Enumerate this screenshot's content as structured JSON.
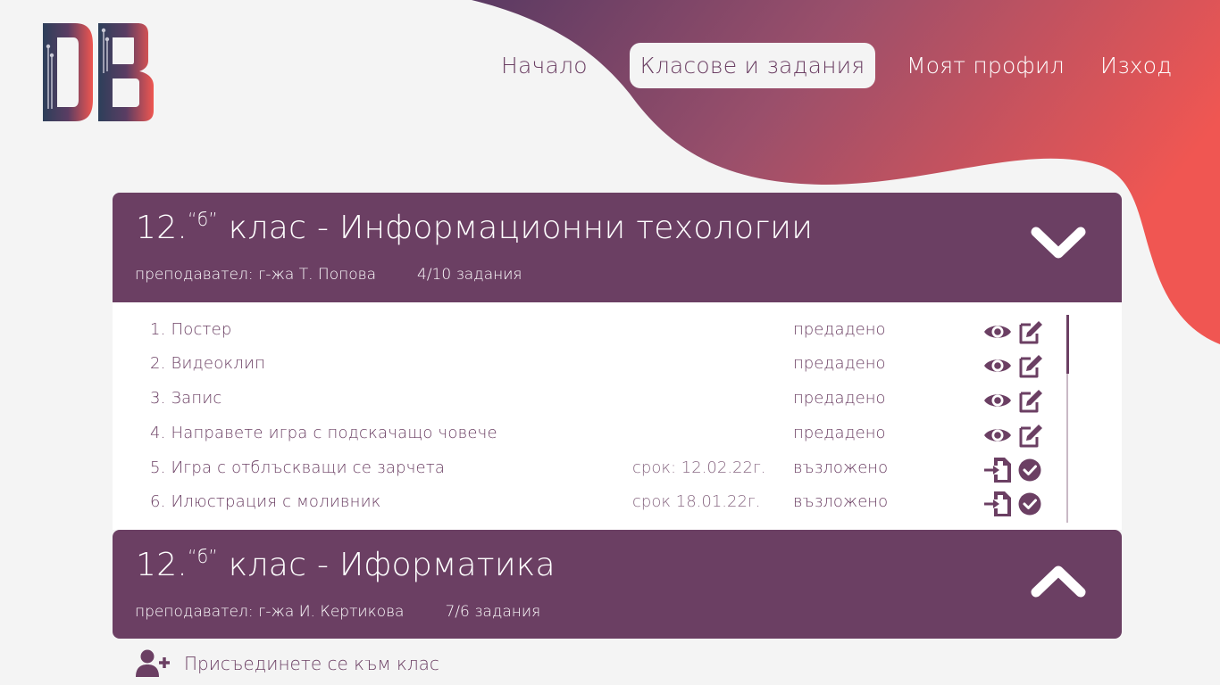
{
  "colors": {
    "primary": "#6b3f63",
    "accent": "#ef5650",
    "background": "#f4f4f4"
  },
  "logo": {
    "text": "DB",
    "icon": "db-logo-icon"
  },
  "nav": {
    "home": "Начало",
    "classes": "Класове и задания",
    "profile": "Моят профил",
    "exit": "Изход"
  },
  "classes": [
    {
      "grade": "12.",
      "section": "“б”",
      "rest": " клас - Информационни техологии",
      "teacher": "преподавател: г-жа Т. Попова",
      "count": "4/10 задания",
      "expanded": true,
      "toggle_icon": "chevron-down-icon",
      "tasks": [
        {
          "name": "1. Постер",
          "due": "",
          "status": "предадено",
          "actions": [
            "eye-icon",
            "edit-icon"
          ]
        },
        {
          "name": "2. Видеоклип",
          "due": "",
          "status": "предадено",
          "actions": [
            "eye-icon",
            "edit-icon"
          ]
        },
        {
          "name": "3. Запис",
          "due": "",
          "status": "предадено",
          "actions": [
            "eye-icon",
            "edit-icon"
          ]
        },
        {
          "name": "4. Направете игра с подскачащо човече",
          "due": "",
          "status": "предадено",
          "actions": [
            "eye-icon",
            "edit-icon"
          ]
        },
        {
          "name": "5. Игра с отблъскващи се зарчета",
          "due": "срок: 12.02.22г.",
          "status": "възложено",
          "actions": [
            "file-import-icon",
            "check-circle-icon"
          ]
        },
        {
          "name": "6. Илюстрация с моливник",
          "due": "срок 18.01.22г.",
          "status": "възложено",
          "actions": [
            "file-import-icon",
            "check-circle-icon"
          ]
        }
      ]
    },
    {
      "grade": "12.",
      "section": "“б”",
      "rest": " клас - Иформатика",
      "teacher": "преподавател: г-жа И. Кертикова",
      "count": "7/6 задания",
      "expanded": false,
      "toggle_icon": "chevron-up-icon"
    }
  ],
  "join": {
    "label": "Присъединете се към клас",
    "icon": "user-plus-icon"
  }
}
